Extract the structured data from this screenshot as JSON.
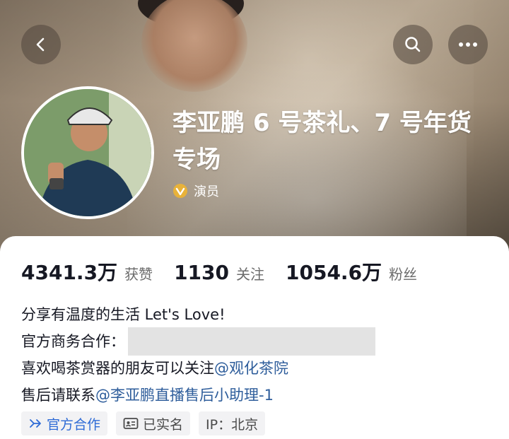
{
  "header": {
    "title": "李亚鹏 6 号茶礼、7 号年货专场",
    "verified_label": "演员",
    "icons": {
      "back": "back-arrow-icon",
      "search": "search-icon",
      "more": "more-icon",
      "verified": "verified-badge-icon"
    }
  },
  "stats": [
    {
      "value": "4341.3万",
      "label": "获赞"
    },
    {
      "value": "1130",
      "label": "关注"
    },
    {
      "value": "1054.6万",
      "label": "粉丝"
    }
  ],
  "bio": {
    "line1": "分享有温度的生活 Let's Love!",
    "line2_prefix": "官方商务合作：",
    "line3_prefix": "喜欢喝茶赏器的朋友可以关注 ",
    "line3_mention": "@观化茶院",
    "line4_prefix": "售后请联系 ",
    "line4_mention": "@李亚鹏直播售后小助理-1"
  },
  "tags": [
    {
      "label": "官方合作",
      "icon": "official-cooperation-icon"
    },
    {
      "label": "已实名",
      "icon": "id-card-icon"
    },
    {
      "label": "IP：北京",
      "icon": ""
    }
  ],
  "colors": {
    "mention": "#2e5d9b",
    "official_tag": "#2e6bd6",
    "verified_badge": "#e8b23a"
  }
}
